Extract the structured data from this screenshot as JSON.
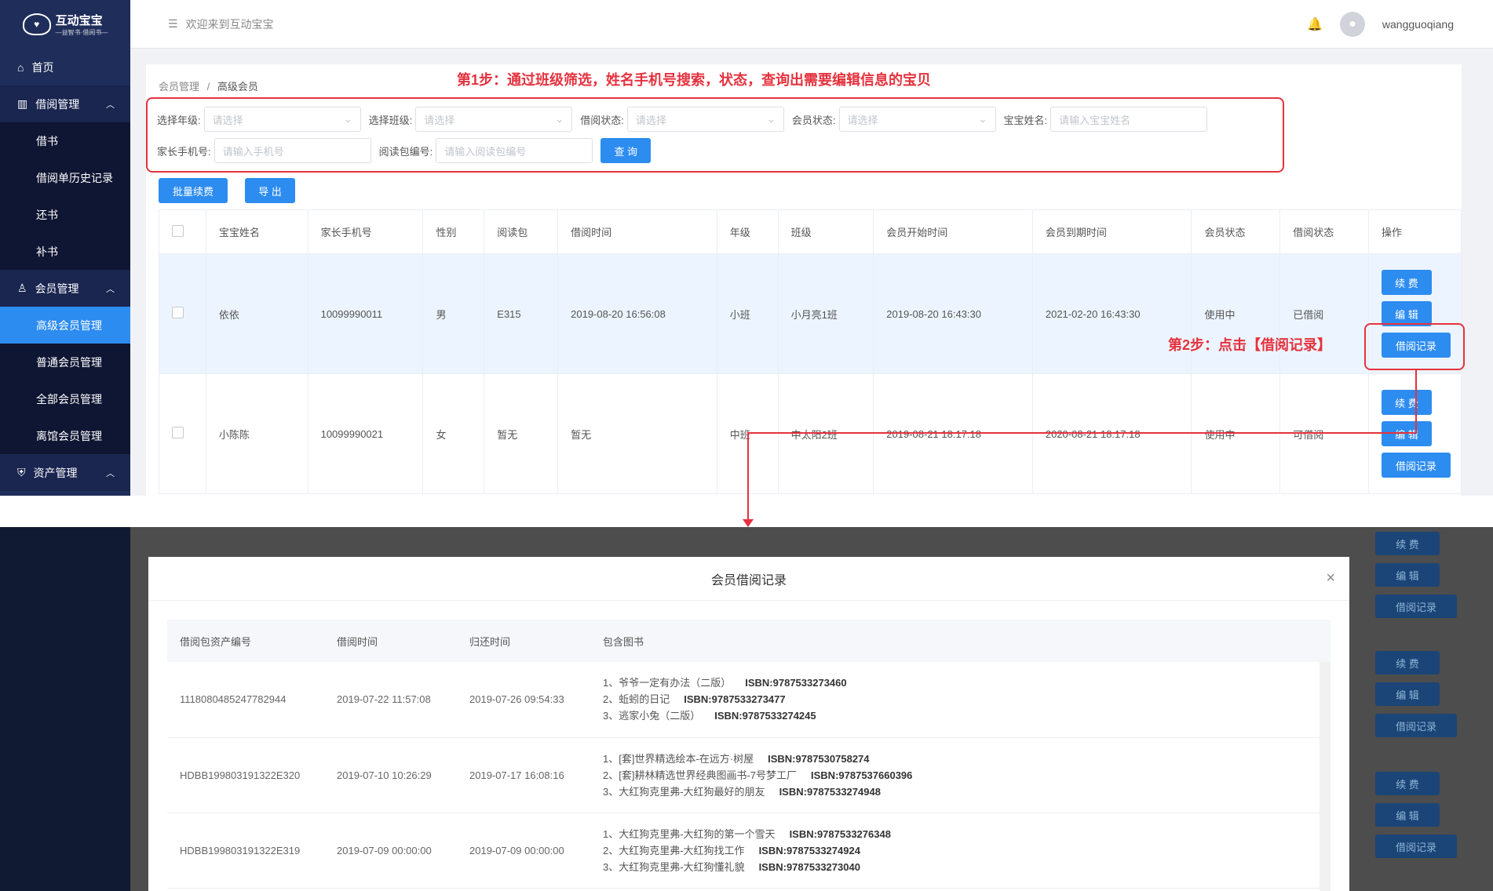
{
  "sidebar": {
    "logo_text": "互动宝宝",
    "logo_sub": "—益智书·借阅书—",
    "items": [
      {
        "label": "首页",
        "icon": "home-icon"
      },
      {
        "label": "借阅管理",
        "icon": "borrow-icon",
        "group": true
      },
      {
        "label": "借书"
      },
      {
        "label": "借阅单历史记录"
      },
      {
        "label": "还书"
      },
      {
        "label": "补书"
      },
      {
        "label": "会员管理",
        "icon": "member-icon",
        "group": true
      },
      {
        "label": "高级会员管理",
        "active": true
      },
      {
        "label": "普通会员管理"
      },
      {
        "label": "全部会员管理"
      },
      {
        "label": "离馆会员管理"
      },
      {
        "label": "资产管理",
        "icon": "asset-icon",
        "group": true
      }
    ]
  },
  "header": {
    "welcome": "欢迎来到互动宝宝",
    "username": "wangguoqiang"
  },
  "breadcrumb": {
    "parent": "会员管理",
    "sep": "/",
    "current": "高级会员"
  },
  "annotations": {
    "step1": "第1步：通过班级筛选，姓名手机号搜索，状态，查询出需要编辑信息的宝贝",
    "step2": "第2步：点击【借阅记录】"
  },
  "filters": {
    "grade_label": "选择年级:",
    "class_label": "选择班级:",
    "borrow_status_label": "借阅状态:",
    "member_status_label": "会员状态:",
    "baby_name_label": "宝宝姓名:",
    "select_placeholder": "请选择",
    "baby_name_placeholder": "请输入宝宝姓名",
    "phone_label": "家长手机号:",
    "phone_placeholder": "请输入手机号",
    "package_label": "阅读包编号:",
    "package_placeholder": "请输入阅读包编号",
    "query_button": "查 询"
  },
  "actions": {
    "batch_renew": "批量续费",
    "export": "导 出"
  },
  "table": {
    "columns": [
      "宝宝姓名",
      "家长手机号",
      "性别",
      "阅读包",
      "借阅时间",
      "年级",
      "班级",
      "会员开始时间",
      "会员到期时间",
      "会员状态",
      "借阅状态",
      "操作"
    ],
    "rows": [
      {
        "name": "依依",
        "phone": "10099990011",
        "gender": "男",
        "package": "E315",
        "borrow_time": "2019-08-20 16:56:08",
        "grade": "小班",
        "class": "小月亮1班",
        "start": "2019-08-20 16:43:30",
        "end": "2021-02-20 16:43:30",
        "member_status": "使用中",
        "borrow_status": "已借阅"
      },
      {
        "name": "小陈陈",
        "phone": "10099990021",
        "gender": "女",
        "package": "暂无",
        "borrow_time": "暂无",
        "grade": "中班",
        "class": "中太阳2班",
        "start": "2019-08-21 18:17:18",
        "end": "2020-08-21 18:17:18",
        "member_status": "使用中",
        "borrow_status": "可借阅"
      }
    ],
    "op_renew": "续 费",
    "op_edit": "编 辑",
    "op_record": "借阅记录"
  },
  "modal": {
    "title": "会员借阅记录",
    "close": "×",
    "columns": [
      "借阅包资产编号",
      "借阅时间",
      "归还时间",
      "包含图书"
    ],
    "rows": [
      {
        "asset": "1118080485247782944",
        "borrow": "2019-07-22 11:57:08",
        "return": "2019-07-26 09:54:33",
        "books": [
          [
            "1、爷爷一定有办法（二版）",
            "ISBN:9787533273460"
          ],
          [
            "2、蚯蚓的日记",
            "ISBN:9787533273477"
          ],
          [
            "3、逃家小兔（二版）",
            "ISBN:9787533274245"
          ]
        ]
      },
      {
        "asset": "HDBB199803191322E320",
        "borrow": "2019-07-10 10:26:29",
        "return": "2019-07-17 16:08:16",
        "books": [
          [
            "1、[套]世界精选绘本-在远方·树屋",
            "ISBN:9787530758274"
          ],
          [
            "2、[套]耕林精选世界经典图画书-7号梦工厂",
            "ISBN:9787537660396"
          ],
          [
            "3、大红狗克里弗-大红狗最好的朋友",
            "ISBN:9787533274948"
          ]
        ]
      },
      {
        "asset": "HDBB199803191322E319",
        "borrow": "2019-07-09 00:00:00",
        "return": "2019-07-09 00:00:00",
        "books": [
          [
            "1、大红狗克里弗-大红狗的第一个雪天",
            "ISBN:9787533276348"
          ],
          [
            "2、大红狗克里弗-大红狗找工作",
            "ISBN:9787533274924"
          ],
          [
            "3、大红狗克里弗-大红狗懂礼貌",
            "ISBN:9787533273040"
          ]
        ]
      }
    ]
  },
  "colors": {
    "primary": "#2d8cf0",
    "sidebar": "#1f2d5a",
    "annotation": "#e5323e"
  }
}
